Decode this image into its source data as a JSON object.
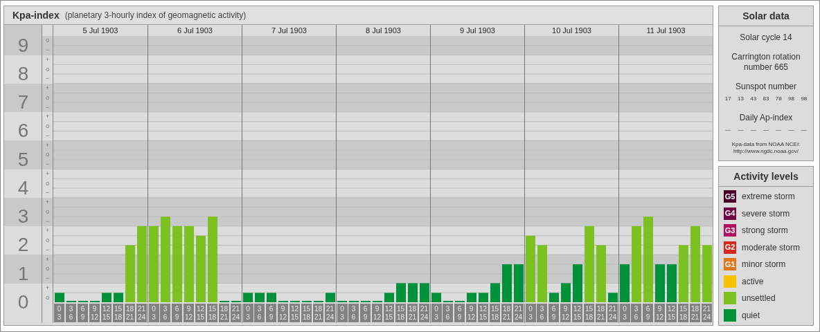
{
  "y_bands": [
    {
      "marks": [
        "o",
        "−"
      ]
    },
    {
      "marks": [
        "+",
        "o",
        "−"
      ]
    },
    {
      "marks": [
        "+",
        "o",
        "−"
      ]
    },
    {
      "marks": [
        "+",
        "o",
        "−"
      ]
    },
    {
      "marks": [
        "+",
        "o",
        "−"
      ]
    },
    {
      "marks": [
        "+",
        "o",
        "−"
      ]
    },
    {
      "marks": [
        "+",
        "o",
        "−"
      ]
    },
    {
      "marks": [
        "+",
        "o",
        "−"
      ]
    },
    {
      "marks": [
        "+",
        "o",
        "−"
      ]
    },
    {
      "marks": [
        "+",
        "o"
      ]
    }
  ],
  "subtitle": "(planetary 3-hourly index of geomagnetic activity)",
  "days": [
    {
      "date": "5 Jul 1903",
      "slots": [
        {
          "from": "0",
          "to": "3"
        },
        {
          "from": "3",
          "to": "6"
        },
        {
          "from": "6",
          "to": "9"
        },
        {
          "from": "9",
          "to": "12"
        },
        {
          "from": "12",
          "to": "15"
        },
        {
          "from": "15",
          "to": "18"
        },
        {
          "from": "18",
          "to": "21"
        },
        {
          "from": "21",
          "to": "24"
        }
      ]
    },
    {
      "date": "6 Jul 1903",
      "slots": [
        {
          "from": "0",
          "to": "3"
        },
        {
          "from": "3",
          "to": "6"
        },
        {
          "from": "6",
          "to": "9"
        },
        {
          "from": "9",
          "to": "12"
        },
        {
          "from": "12",
          "to": "15"
        },
        {
          "from": "15",
          "to": "18"
        },
        {
          "from": "18",
          "to": "21"
        },
        {
          "from": "21",
          "to": "24"
        }
      ]
    },
    {
      "date": "7 Jul 1903",
      "slots": [
        {
          "from": "0",
          "to": "3"
        },
        {
          "from": "3",
          "to": "6"
        },
        {
          "from": "6",
          "to": "9"
        },
        {
          "from": "9",
          "to": "12"
        },
        {
          "from": "12",
          "to": "15"
        },
        {
          "from": "15",
          "to": "18"
        },
        {
          "from": "18",
          "to": "21"
        },
        {
          "from": "21",
          "to": "24"
        }
      ]
    },
    {
      "date": "8 Jul 1903",
      "slots": [
        {
          "from": "0",
          "to": "3"
        },
        {
          "from": "3",
          "to": "6"
        },
        {
          "from": "6",
          "to": "9"
        },
        {
          "from": "9",
          "to": "12"
        },
        {
          "from": "12",
          "to": "15"
        },
        {
          "from": "15",
          "to": "18"
        },
        {
          "from": "18",
          "to": "21"
        },
        {
          "from": "21",
          "to": "24"
        }
      ]
    },
    {
      "date": "9 Jul 1903",
      "slots": [
        {
          "from": "0",
          "to": "3"
        },
        {
          "from": "3",
          "to": "6"
        },
        {
          "from": "6",
          "to": "9"
        },
        {
          "from": "9",
          "to": "12"
        },
        {
          "from": "12",
          "to": "15"
        },
        {
          "from": "15",
          "to": "18"
        },
        {
          "from": "18",
          "to": "21"
        },
        {
          "from": "21",
          "to": "24"
        }
      ]
    },
    {
      "date": "10 Jul 1903",
      "slots": [
        {
          "from": "0",
          "to": "3"
        },
        {
          "from": "3",
          "to": "6"
        },
        {
          "from": "6",
          "to": "9"
        },
        {
          "from": "9",
          "to": "12"
        },
        {
          "from": "12",
          "to": "15"
        },
        {
          "from": "15",
          "to": "18"
        },
        {
          "from": "18",
          "to": "21"
        },
        {
          "from": "21",
          "to": "24"
        }
      ]
    },
    {
      "date": "11 Jul 1903",
      "slots": [
        {
          "from": "0",
          "to": "3"
        },
        {
          "from": "3",
          "to": "6"
        },
        {
          "from": "6",
          "to": "9"
        },
        {
          "from": "9",
          "to": "12"
        },
        {
          "from": "12",
          "to": "15"
        },
        {
          "from": "15",
          "to": "18"
        },
        {
          "from": "18",
          "to": "21"
        },
        {
          "from": "21",
          "to": "24"
        }
      ]
    }
  ],
  "chart_data": {
    "type": "bar",
    "title": "Kpa-index",
    "grid": true,
    "ylim": [
      0,
      9.33
    ],
    "bands": [
      {
        "axis": "y",
        "from": 8.67,
        "to": 9.33
      },
      {
        "axis": "y",
        "from": 6.67,
        "to": 7.67
      },
      {
        "axis": "y",
        "from": 4.67,
        "to": 5.67
      },
      {
        "axis": "y",
        "from": 2.67,
        "to": 3.67
      },
      {
        "axis": "y",
        "from": 0.67,
        "to": 1.67
      }
    ],
    "categories": [
      null,
      null,
      null,
      null,
      null,
      null,
      null,
      null,
      null,
      null,
      null,
      null,
      null,
      null,
      null,
      null,
      null,
      null,
      null,
      null,
      null,
      null,
      null,
      null,
      null,
      null,
      null,
      null,
      null,
      null,
      null,
      null,
      null,
      null,
      null,
      null,
      null,
      null,
      null,
      null,
      null,
      null,
      null,
      null,
      null,
      null,
      null,
      null,
      null,
      null,
      null,
      null,
      null,
      null,
      null,
      null
    ],
    "yticks": [
      {
        "value": 0,
        "label": "0"
      },
      {
        "value": 1,
        "label": "1"
      },
      {
        "value": 2,
        "label": "2"
      },
      {
        "value": 3,
        "label": "3"
      },
      {
        "value": 4,
        "label": "4"
      },
      {
        "value": 5,
        "label": "5"
      },
      {
        "value": 6,
        "label": "6"
      },
      {
        "value": 7,
        "label": "7"
      },
      {
        "value": 8,
        "label": "8"
      },
      {
        "value": 9,
        "label": "9"
      }
    ],
    "series": [
      {
        "values": [
          0.33,
          0,
          0,
          0,
          0.33,
          0.33,
          2,
          2.67,
          2.67,
          3,
          2.67,
          2.67,
          2.33,
          3,
          0,
          0,
          0.33,
          0.33,
          0.33,
          0,
          0,
          0,
          0,
          0.33,
          0,
          0,
          0,
          0,
          0.33,
          0.67,
          0.67,
          0.67,
          0.33,
          0,
          0,
          0.33,
          0.33,
          0.67,
          1.33,
          1.33,
          2.33,
          2,
          0.33,
          0.67,
          1.33,
          2.67,
          2,
          0.33,
          1.33,
          2.67,
          3,
          1.33,
          1.33,
          2,
          2.67,
          2
        ]
      }
    ]
  },
  "solar_data": {
    "title": "Solar data",
    "solar_cycle": "Solar cycle 14",
    "carrington": "Carrington rotation number 665",
    "sunspot_title": "Sunspot number",
    "sunspot_numbers": [
      "17",
      "13",
      "43",
      "83",
      "78",
      "98",
      "98"
    ],
    "ap_title": "Daily Ap-index",
    "ap_values": [
      "—",
      "—",
      "—",
      "—",
      "—",
      "—",
      "—"
    ],
    "source": "Kpa-data from NOAA NCEI:",
    "source_url": "http://www.ngdc.noaa.gov/"
  },
  "activity_levels": {
    "title": "Activity levels",
    "items": [
      {
        "badge": "G5",
        "label": "extreme storm",
        "color": "#4c0029"
      },
      {
        "badge": "G4",
        "label": "severe storm",
        "color": "#6e0742"
      },
      {
        "badge": "G3",
        "label": "strong storm",
        "color": "#b0105e"
      },
      {
        "badge": "G2",
        "label": "moderate storm",
        "color": "#d4281c"
      },
      {
        "badge": "G1",
        "label": "minor storm",
        "color": "#e2741a"
      },
      {
        "label": "active",
        "color": "#f7c300"
      },
      {
        "label": "unsettled",
        "color": "#7bc122"
      },
      {
        "label": "quiet",
        "color": "#00913c"
      }
    ]
  }
}
